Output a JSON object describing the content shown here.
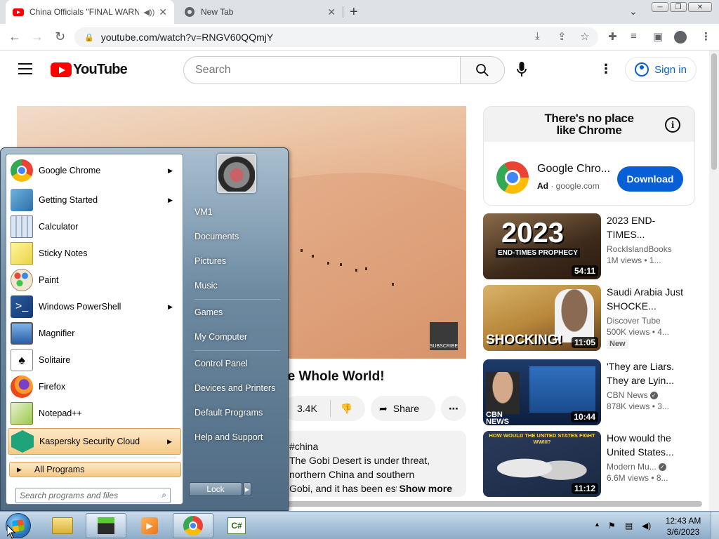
{
  "browser": {
    "tabs": [
      {
        "title": "China Officials \"FINAL WARNING\"",
        "active": true
      },
      {
        "title": "New Tab",
        "active": false
      }
    ],
    "url": "youtube.com/watch?v=RNGV60QQmjY"
  },
  "youtube": {
    "logo": "YouTube",
    "search_placeholder": "Search",
    "signin": "Sign in"
  },
  "video": {
    "title": "he Whole World!",
    "likes": "3.4K",
    "share": "Share",
    "badge": "SUBSCRIBE",
    "desc_tag": "#china",
    "desc_line1": "The Gobi Desert is under threat,",
    "desc_line2": "northern China and southern",
    "desc_line3": "Gobi, and it has been est",
    "show_more": "Show more"
  },
  "ad": {
    "banner_line1": "There's no place",
    "banner_line2": "like Chrome",
    "name": "Google Chro...",
    "label": "Ad",
    "domain": "google.com",
    "download": "Download"
  },
  "related": [
    {
      "title": "2023 END-TIMES...",
      "channel": "RockIslandBooks",
      "views": "1M views • 1...",
      "duration": "54:11",
      "thumb_text": "2023",
      "thumb_sub": "END-TIMES PROPHECY"
    },
    {
      "title": "Saudi Arabia Just SHOCKE...",
      "channel": "Discover Tube",
      "views": "500K views • 4...",
      "duration": "11:05",
      "badge": "New",
      "thumb_text": "SHOCKING!"
    },
    {
      "title": "'They are Liars. They are Lyin...",
      "channel": "CBN News",
      "views": "878K views • 3...",
      "duration": "10:44",
      "thumb_text": "CBN NEWS"
    },
    {
      "title": "How would the United States...",
      "channel": "Modern Mu...",
      "views": "6.6M views • 8...",
      "duration": "11:12",
      "thumb_text": "HOW WOULD THE UNITED STATES FIGHT WWIII?"
    }
  ],
  "startmenu": {
    "programs": [
      {
        "label": "Google Chrome",
        "icon": "chrome-icon",
        "arrow": true
      },
      {
        "label": "Getting Started",
        "icon": "getting-started-icon",
        "arrow": true
      },
      {
        "label": "Calculator",
        "icon": "calculator-icon",
        "arrow": false
      },
      {
        "label": "Sticky Notes",
        "icon": "sticky-notes-icon",
        "arrow": false
      },
      {
        "label": "Paint",
        "icon": "paint-icon",
        "arrow": false
      },
      {
        "label": "Windows PowerShell",
        "icon": "powershell-icon",
        "arrow": true
      },
      {
        "label": "Magnifier",
        "icon": "magnifier-icon",
        "arrow": false
      },
      {
        "label": "Solitaire",
        "icon": "solitaire-icon",
        "arrow": false
      },
      {
        "label": "Firefox",
        "icon": "firefox-icon",
        "arrow": false
      },
      {
        "label": "Notepad++",
        "icon": "notepadpp-icon",
        "arrow": false
      },
      {
        "label": "Kaspersky Security Cloud",
        "icon": "kaspersky-icon",
        "arrow": true
      }
    ],
    "all_programs": "All Programs",
    "search_placeholder": "Search programs and files",
    "right_links": [
      "VM1",
      "Documents",
      "Pictures",
      "Music",
      "Games",
      "My Computer",
      "Control Panel",
      "Devices and Printers",
      "Default Programs",
      "Help and Support"
    ],
    "lock": "Lock"
  },
  "taskbar": {
    "time": "12:43 AM",
    "date": "3/6/2023"
  }
}
